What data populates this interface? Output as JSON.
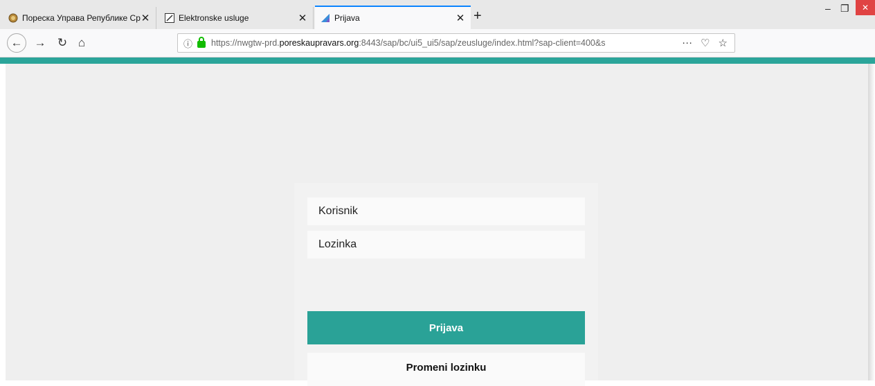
{
  "browser": {
    "tabs": [
      {
        "title": "Пореска Управа Републике Ср",
        "close": "✕"
      },
      {
        "title": "Elektronske usluge",
        "close": "✕"
      },
      {
        "title": "Prijava",
        "close": "✕"
      }
    ],
    "new_tab": "+",
    "url_prefix": "https://nwgtw-prd.",
    "url_domain": "poreskaupravars.org",
    "url_suffix": ":8443/sap/bc/ui5_ui5/sap/zeusluge/index.html?sap-client=400&s",
    "accent_color": "#2ba59a"
  },
  "login": {
    "username_placeholder": "Korisnik",
    "password_placeholder": "Lozinka",
    "login_button": "Prijava",
    "change_password_button": "Promeni lozinku"
  }
}
